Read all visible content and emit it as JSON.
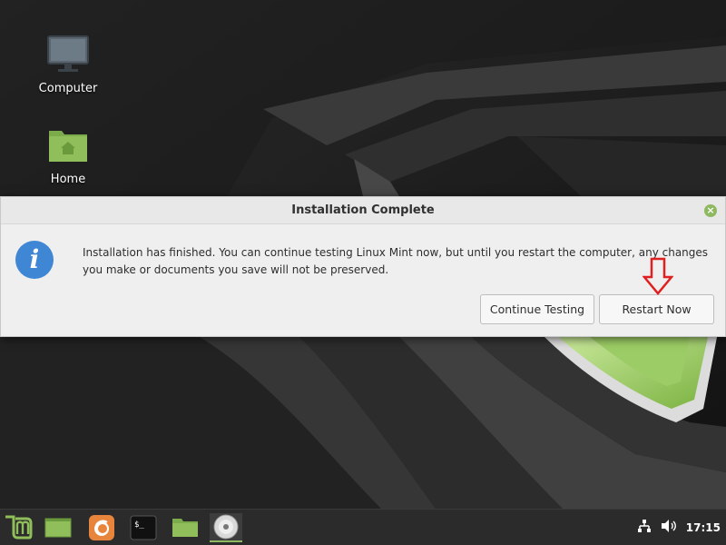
{
  "desktop": {
    "icons": [
      {
        "label": "Computer",
        "icon": "monitor-icon"
      },
      {
        "label": "Home",
        "icon": "home-folder-icon"
      }
    ]
  },
  "dialog": {
    "title": "Installation Complete",
    "message": "Installation has finished.  You can continue testing Linux Mint now, but until you restart the computer, any changes you make or documents you save will not be preserved.",
    "icon": "info-icon",
    "buttons": {
      "continue": "Continue Testing",
      "restart": "Restart Now"
    }
  },
  "taskbar": {
    "items": [
      {
        "name": "menu",
        "icon": "mint-menu-icon"
      },
      {
        "name": "show-desktop",
        "icon": "show-desktop-icon"
      },
      {
        "name": "firefox",
        "icon": "firefox-icon"
      },
      {
        "name": "terminal",
        "icon": "terminal-icon"
      },
      {
        "name": "files",
        "icon": "folder-icon"
      },
      {
        "name": "installer",
        "icon": "disc-icon",
        "active": true
      }
    ],
    "clock": "17:15"
  },
  "colors": {
    "accent": "#8fb960",
    "info": "#3f86d4",
    "annotation": "#e02020"
  }
}
